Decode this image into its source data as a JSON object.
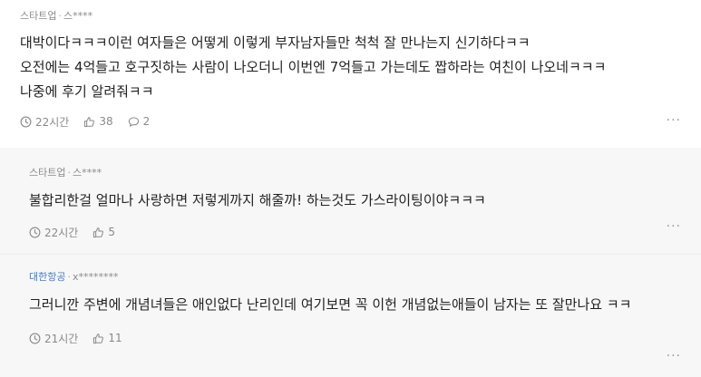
{
  "comments": [
    {
      "company": "스타트업",
      "user": "스****",
      "text": "대박이다ㅋㅋㅋ이런 여자들은 어떻게 이렇게 부자남자들만 척척 잘 만나는지 신기하다ㅋㅋ\n오전에는 4억들고 호구짓하는 사람이 나오더니 이번엔 7억들고 가는데도 짭하라는 여친이 나오네ㅋㅋㅋ\n나중에 후기 알려줘ㅋㅋ",
      "time": "22시간",
      "likes": "38",
      "replies": "2"
    }
  ],
  "replies": [
    {
      "company": "스타트업",
      "user": "스****",
      "text": "불합리한걸 얼마나 사랑하면 저렇게까지 해줄까! 하는것도 가스라이팅이야ㅋㅋㅋ",
      "time": "22시간",
      "likes": "5"
    },
    {
      "company": "대한항공",
      "user": "x********",
      "text": "그러니깐 주변에 개념녀들은 애인없다 난리인데 여기보면 꼭 이헌 개념없는애들이 남자는 또 잘만나요 ㅋㅋ",
      "time": "21시간",
      "likes": "11"
    }
  ],
  "ui": {
    "separator": "·",
    "more": "···",
    "icons": [
      "clock-icon",
      "thumbs-up-icon",
      "comment-icon",
      "more-icon"
    ],
    "colors": {
      "company_link": "#4a7bb7",
      "meta": "#8a8a8a",
      "reply_bg": "#f7f7f7"
    }
  }
}
